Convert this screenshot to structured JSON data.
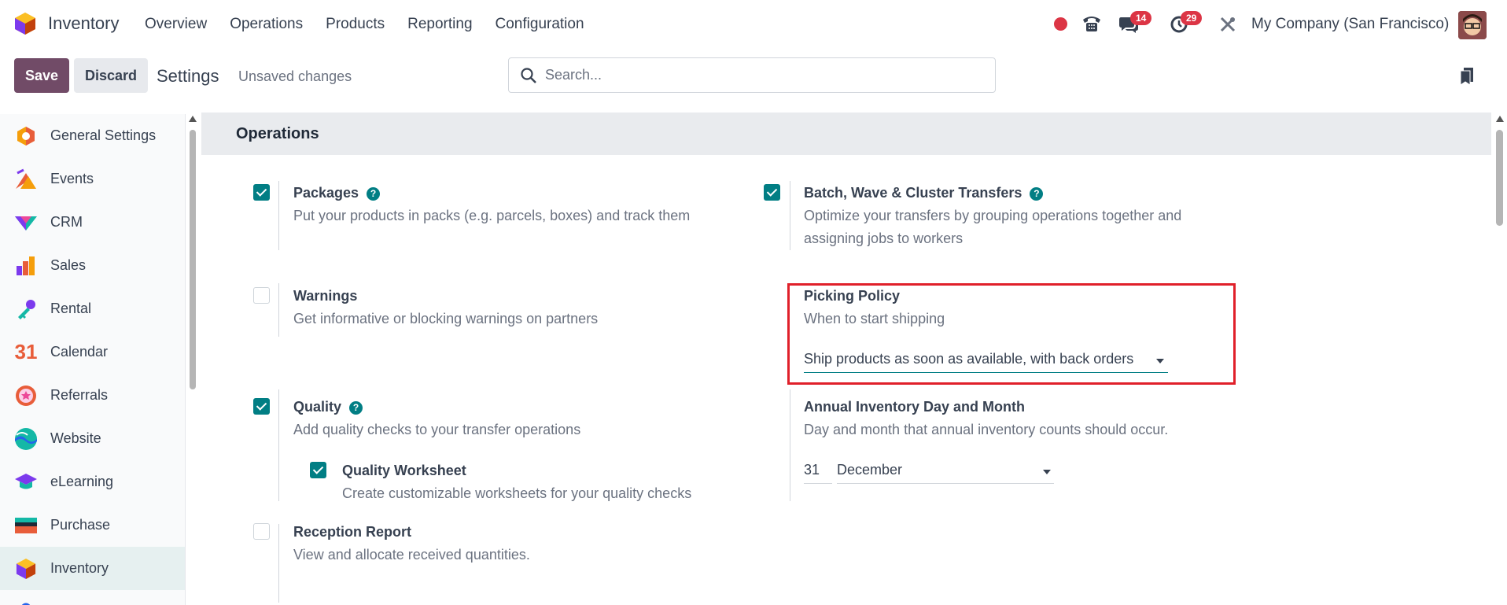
{
  "navbar": {
    "app_name": "Inventory",
    "menu": [
      "Overview",
      "Operations",
      "Products",
      "Reporting",
      "Configuration"
    ],
    "messages_count": "14",
    "activities_count": "29",
    "company": "My Company (San Francisco)"
  },
  "control_panel": {
    "save_label": "Save",
    "discard_label": "Discard",
    "title": "Settings",
    "status": "Unsaved changes",
    "search_placeholder": "Search..."
  },
  "sidebar": {
    "items": [
      {
        "label": "General Settings",
        "icon": "general-settings-icon"
      },
      {
        "label": "Events",
        "icon": "events-icon"
      },
      {
        "label": "CRM",
        "icon": "crm-icon"
      },
      {
        "label": "Sales",
        "icon": "sales-icon"
      },
      {
        "label": "Rental",
        "icon": "rental-icon"
      },
      {
        "label": "Calendar",
        "icon": "calendar-icon",
        "icon_text": "31"
      },
      {
        "label": "Referrals",
        "icon": "referrals-icon"
      },
      {
        "label": "Website",
        "icon": "website-icon"
      },
      {
        "label": "eLearning",
        "icon": "elearning-icon"
      },
      {
        "label": "Purchase",
        "icon": "purchase-icon"
      },
      {
        "label": "Inventory",
        "icon": "inventory-icon",
        "active": true
      }
    ]
  },
  "section": {
    "title": "Operations",
    "packages": {
      "title": "Packages",
      "desc": "Put your products in packs (e.g. parcels, boxes) and track them",
      "checked": true
    },
    "batch": {
      "title": "Batch, Wave & Cluster Transfers",
      "desc": "Optimize your transfers by grouping operations together and assigning jobs to workers",
      "checked": true
    },
    "warnings": {
      "title": "Warnings",
      "desc": "Get informative or blocking warnings on partners",
      "checked": false
    },
    "picking": {
      "title": "Picking Policy",
      "desc": "When to start shipping",
      "value": "Ship products as soon as available, with back orders"
    },
    "quality": {
      "title": "Quality",
      "desc": "Add quality checks to your transfer operations",
      "checked": true
    },
    "quality_worksheet": {
      "title": "Quality Worksheet",
      "desc": "Create customizable worksheets for your quality checks",
      "checked": true
    },
    "annual": {
      "title": "Annual Inventory Day and Month",
      "desc": "Day and month that annual inventory counts should occur.",
      "day": "31",
      "month": "December"
    },
    "reception": {
      "title": "Reception Report",
      "desc": "View and allocate received quantities.",
      "checked": false
    }
  },
  "colors": {
    "brand": "#714b67",
    "accent": "#017e84",
    "highlight": "#e0202a"
  }
}
